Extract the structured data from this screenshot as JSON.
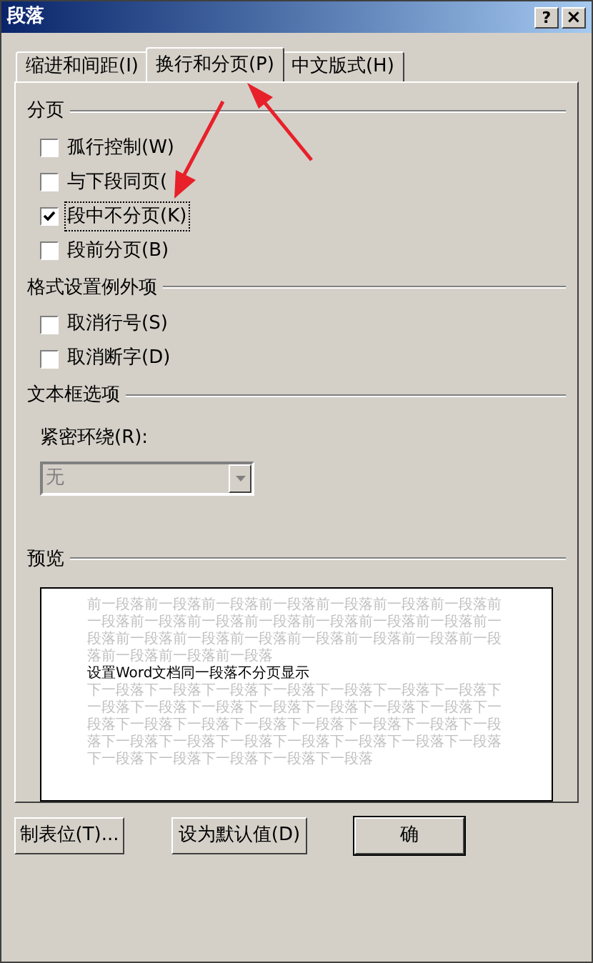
{
  "window": {
    "title": "段落",
    "help": "?",
    "close": "×"
  },
  "tabs": [
    {
      "label": "缩进和间距(I)",
      "selected": false
    },
    {
      "label": "换行和分页(P)",
      "selected": true
    },
    {
      "label": "中文版式(H)",
      "selected": false
    }
  ],
  "groups": [
    {
      "title": "分页",
      "checkboxes": [
        {
          "label": "孤行控制(W)",
          "checked": false,
          "focused": false
        },
        {
          "label": "与下段同页(",
          "checked": false,
          "focused": false
        },
        {
          "label": "段中不分页(K)",
          "checked": true,
          "focused": true
        },
        {
          "label": "段前分页(B)",
          "checked": false,
          "focused": false
        }
      ]
    },
    {
      "title": "格式设置例外项",
      "checkboxes": [
        {
          "label": "取消行号(S)",
          "checked": false,
          "focused": false
        },
        {
          "label": "取消断字(D)",
          "checked": false,
          "focused": false
        }
      ]
    }
  ],
  "textbox_options": {
    "title": "文本框选项",
    "label": "紧密环绕(R):",
    "value": "无",
    "disabled": true
  },
  "preview": {
    "title": "预览",
    "before": "前一段落前一段落前一段落前一段落前一段落前一段落前一段落前一段落前一段落前一段落前一段落前一段落前一段落前一段落前一段落前一段落前一段落前一段落前一段落前一段落前一段落前一段落前一段落前一段落前一段落",
    "sample": "设置Word文档同一段落不分页显示",
    "after": "下一段落下一段落下一段落下一段落下一段落下一段落下一段落下一段落下一段落下一段落下一段落下一段落下一段落下一段落下一段落下一段落下一段落下一段落下一段落下一段落下一段落下一段落下一段落下一段落下一段落下一段落下一段落下一段落下一段落下一段落下一段落下一段落下一段落下一段落"
  },
  "buttons": [
    {
      "label": "制表位(T)...",
      "default": false
    },
    {
      "label": "设为默认值(D)",
      "default": false
    },
    {
      "label": "确",
      "default": true
    }
  ]
}
